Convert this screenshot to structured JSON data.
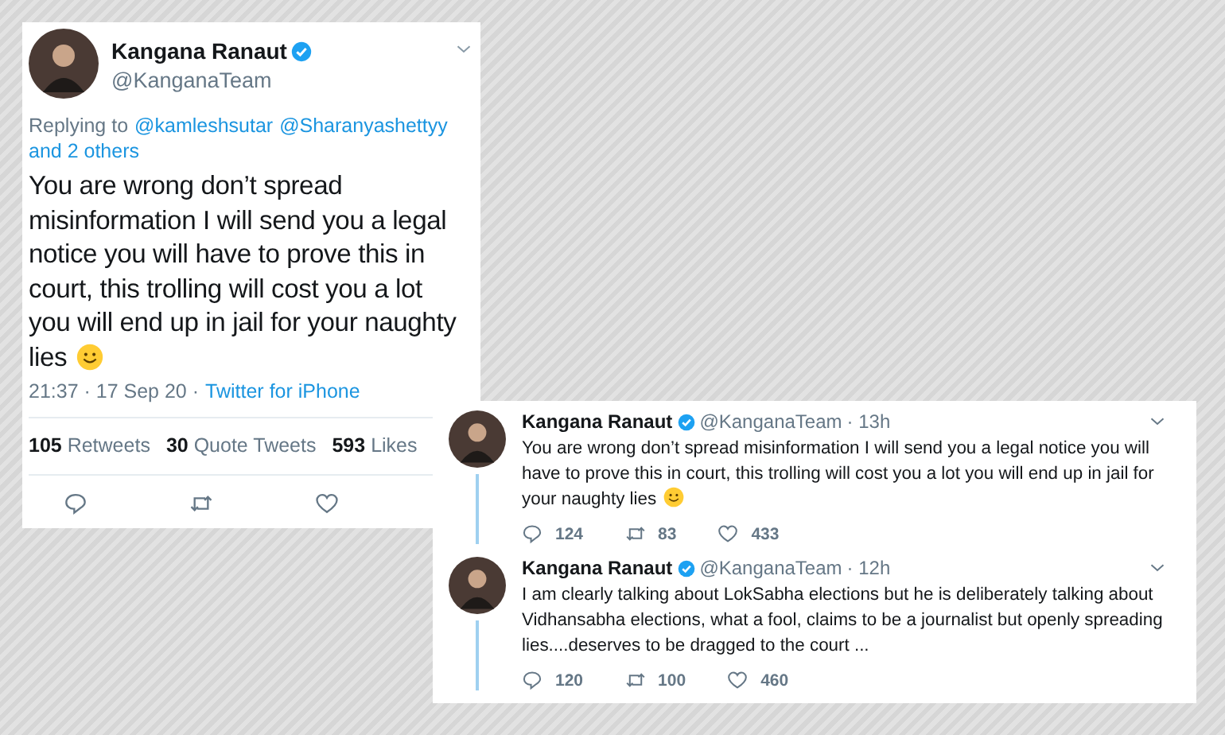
{
  "main_tweet": {
    "name": "Kangana Ranaut",
    "verified": true,
    "handle": "@KanganaTeam",
    "reply_prefix": "Replying to",
    "reply_links": [
      "@kamleshsutar",
      "@Sharanyashettyy",
      "and 2 others"
    ],
    "text": "You are wrong don’t spread misinformation I will send you a legal notice you will have to prove this in court, this trolling will cost you a lot you will end up in jail for your naughty lies",
    "emoji": true,
    "time": "21:37 · 17 Sep 20 ·",
    "source": "Twitter for iPhone",
    "stats": [
      "**105** Retweets",
      "**30** Quote Tweets",
      "**593** Likes"
    ]
  },
  "thread": [
    {
      "name": "Kangana Ranaut",
      "verified": true,
      "handle": "@KanganaTeam",
      "time": "· 13h",
      "text": "You are wrong don’t spread misinformation I will send you a legal notice you will have to prove this in court, this trolling will cost you a lot you will end up in jail for your naughty lies",
      "emoji": true,
      "replies": "124",
      "retweets": "83",
      "likes": "433"
    },
    {
      "name": "Kangana Ranaut",
      "verified": true,
      "handle": "@KanganaTeam",
      "time": "· 12h",
      "text": "I am clearly talking about LokSabha elections but he is deliberately talking about Vidhansabha elections, what a fool, claims to be a journalist but openly spreading lies....deserves to be dragged to the court ...",
      "replies": "120",
      "retweets": "100",
      "likes": "460"
    }
  ]
}
